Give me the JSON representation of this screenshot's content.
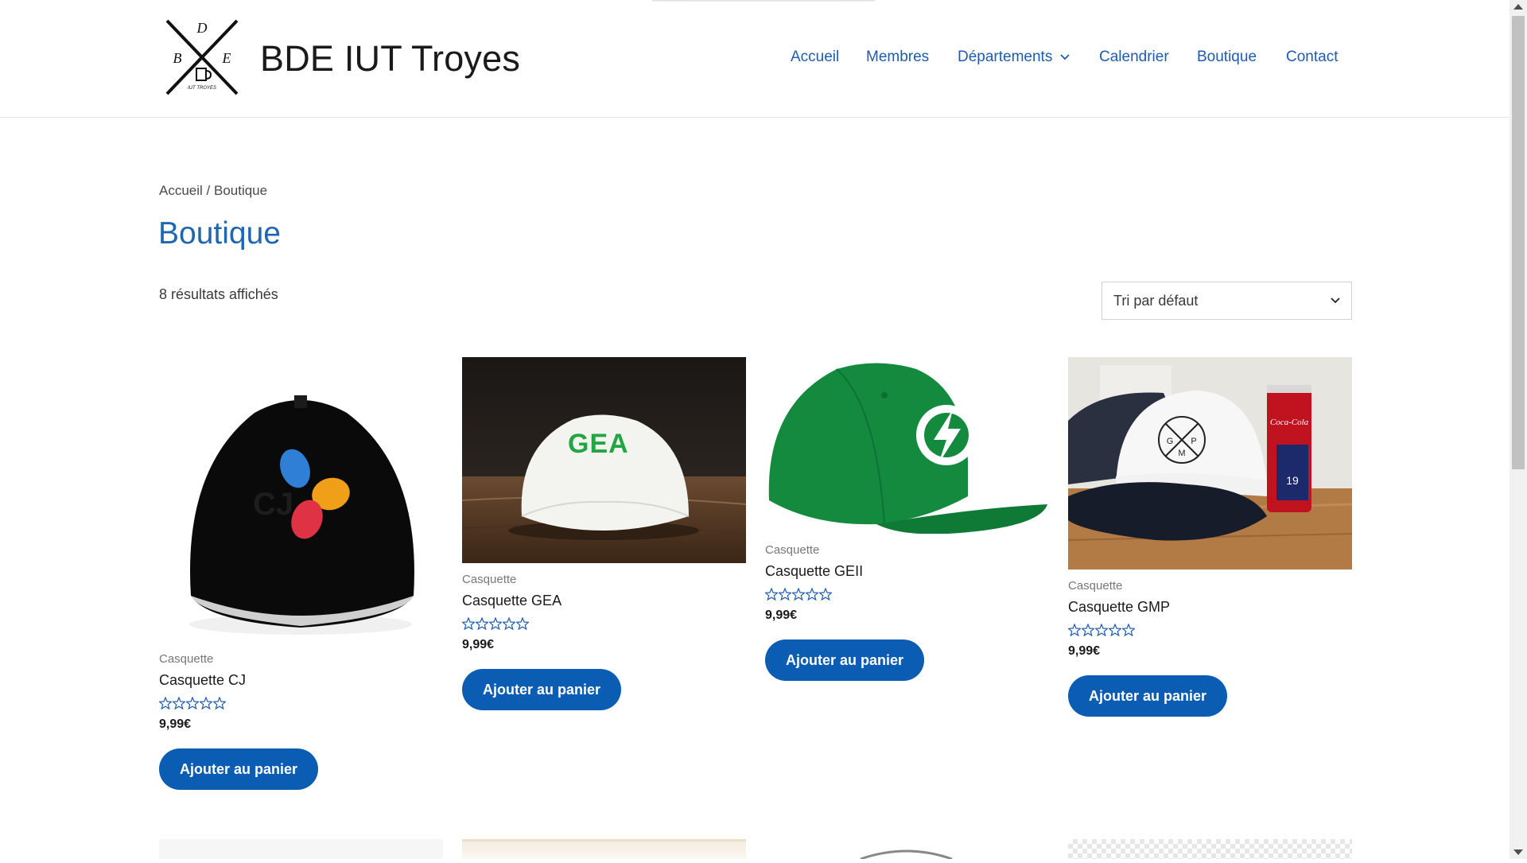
{
  "site": {
    "title": "BDE IUT Troyes",
    "logo_letters": [
      "D",
      "B",
      "E"
    ],
    "logo_caption": "IUT TROYES"
  },
  "nav": {
    "items": [
      "Accueil",
      "Membres",
      "Départements",
      "Calendrier",
      "Boutique",
      "Contact"
    ]
  },
  "breadcrumb": {
    "home": "Accueil",
    "separator": " / ",
    "current": "Boutique"
  },
  "page": {
    "title": "Boutique",
    "result_count": "8 résultats affichés"
  },
  "sort": {
    "selected": "Tri par défaut"
  },
  "products": [
    {
      "category": "Casquette",
      "name": "Casquette CJ",
      "price": "9,99€",
      "rating": 0,
      "button": "Ajouter au panier"
    },
    {
      "category": "Casquette",
      "name": "Casquette GEA",
      "price": "9,99€",
      "rating": 0,
      "button": "Ajouter au panier"
    },
    {
      "category": "Casquette",
      "name": "Casquette GEII",
      "price": "9,99€",
      "rating": 0,
      "button": "Ajouter au panier"
    },
    {
      "category": "Casquette",
      "name": "Casquette GMP",
      "price": "9,99€",
      "rating": 0,
      "button": "Ajouter au panier"
    }
  ],
  "image_text": {
    "cj": "CJ",
    "gea": "GEA",
    "gmp": [
      "G",
      "P",
      "M"
    ],
    "can": "Coca-Cola",
    "can_number": "19"
  },
  "colors": {
    "link": "#1e5bb0",
    "accent": "#0b5cb3",
    "title": "#1e66b2"
  },
  "icons": {
    "star": "star-outline-icon",
    "chevron": "chevron-down-icon"
  }
}
